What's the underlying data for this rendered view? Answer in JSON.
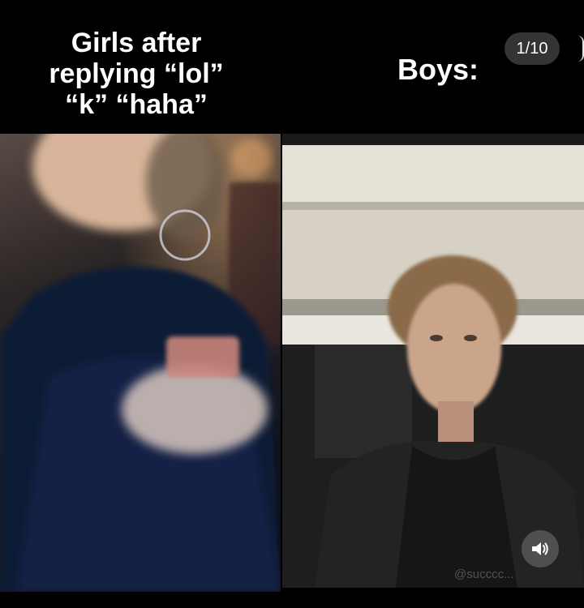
{
  "post": {
    "caption_left": "Girls after\nreplying “lol”\n“k” “haha”",
    "caption_right": "Boys:",
    "counter": "1/10",
    "watermark": "@succcc..."
  },
  "icons": {
    "sound": "speaker-volume-icon",
    "next": "next-slide-hint-icon"
  },
  "colors": {
    "background": "#000000",
    "text": "#ffffff",
    "pill": "#464646"
  }
}
